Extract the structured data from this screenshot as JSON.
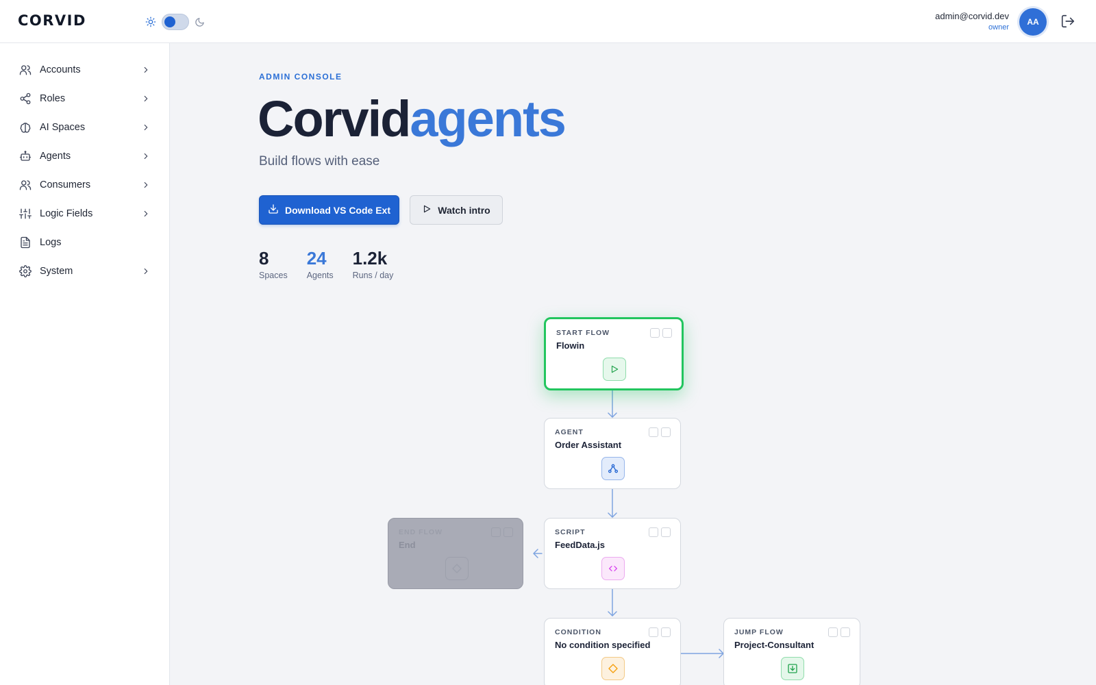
{
  "brand": {
    "name": "CORVID"
  },
  "user": {
    "email": "admin@corvid.dev",
    "role": "owner",
    "initials": "AA"
  },
  "sidebar": {
    "items": [
      {
        "label": "Accounts",
        "icon": "users-icon",
        "has_children": true
      },
      {
        "label": "Roles",
        "icon": "share-nodes-icon",
        "has_children": true
      },
      {
        "label": "AI Spaces",
        "icon": "brain-icon",
        "has_children": true
      },
      {
        "label": "Agents",
        "icon": "robot-icon",
        "has_children": true
      },
      {
        "label": "Consumers",
        "icon": "users-icon",
        "has_children": true
      },
      {
        "label": "Logic Fields",
        "icon": "sliders-icon",
        "has_children": true
      },
      {
        "label": "Logs",
        "icon": "file-text-icon",
        "has_children": false
      },
      {
        "label": "System",
        "icon": "gear-icon",
        "has_children": true
      }
    ]
  },
  "main": {
    "eyebrow": "ADMIN CONSOLE",
    "title_part1": "Corvid",
    "title_part2": "agents",
    "subtitle": "Build flows with ease",
    "primary_button": "Download VS Code Ext",
    "secondary_button": "Watch intro",
    "stats": [
      {
        "value": "8",
        "label": "Spaces"
      },
      {
        "value": "24",
        "label": "Agents"
      },
      {
        "value": "1.2k",
        "label": "Runs / day"
      }
    ]
  },
  "flow": {
    "start": {
      "kind": "START FLOW",
      "title": "Flowin"
    },
    "agent": {
      "kind": "AGENT",
      "title": "Order Assistant"
    },
    "script": {
      "kind": "SCRIPT",
      "title": "FeedData.js"
    },
    "end": {
      "kind": "END FLOW",
      "title": "End"
    },
    "condition": {
      "kind": "CONDITION",
      "title": "No condition specified"
    },
    "jump": {
      "kind": "JUMP FLOW",
      "title": "Project-Consultant"
    }
  },
  "colors": {
    "accent": "#1f62d1",
    "accent_light": "#3a78d8",
    "start_node": "#22c55e"
  }
}
